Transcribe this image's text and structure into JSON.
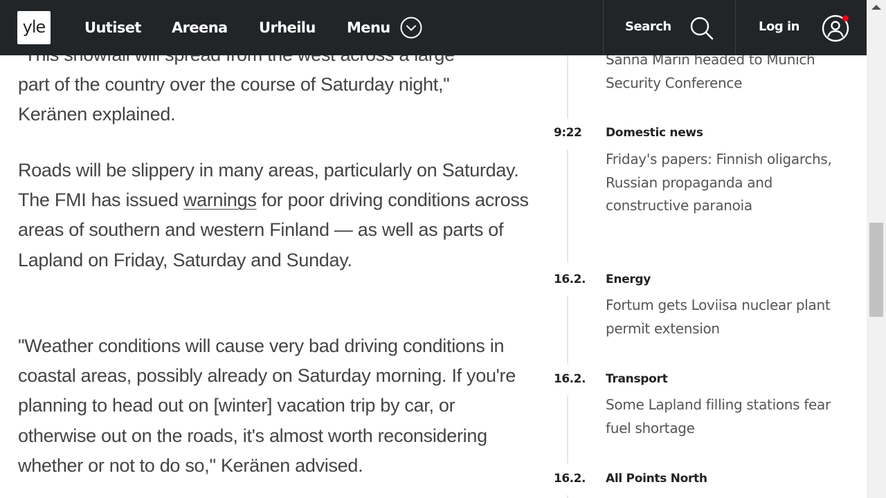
{
  "header": {
    "logo": "yle",
    "nav": [
      "Uutiset",
      "Areena",
      "Urheilu",
      "Menu"
    ],
    "search_label": "Search",
    "login_label": "Log in",
    "notification_color": "#e8001c"
  },
  "article": {
    "paragraphs": [
      {
        "lines": [
          "\"This snowfall will spread from the west across a large",
          "part of the country over the course of Saturday night,\"",
          "Keränen explained."
        ]
      },
      {
        "before_link": "Roads will be slippery in many areas, particularly on Saturday. The FMI has issued ",
        "link": "warnings",
        "after_link": " for poor driving conditions across areas of southern and western Finland — as well as parts of Lapland on Friday, Saturday and Sunday."
      },
      {
        "text": "\"Weather conditions will cause very bad driving conditions in coastal areas, possibly already on Saturday morning. If you're planning to head out on [winter] vacation trip by car, or otherwise out on the roads, it's almost worth reconsidering whether or not to do so,\" Keränen advised."
      }
    ]
  },
  "news_feed": {
    "items": [
      {
        "time": "",
        "category": "",
        "headline": "Sanna Marin headed to Munich Security Conference"
      },
      {
        "time": "9:22",
        "category": "Domestic news",
        "headline": "Friday's papers: Finnish oligarchs, Russian propaganda and constructive paranoia"
      },
      {
        "time": "16.2.",
        "category": "Energy",
        "headline": "Fortum gets Loviisa nuclear plant permit extension"
      },
      {
        "time": "16.2.",
        "category": "Transport",
        "headline": "Some Lapland filling stations fear fuel shortage"
      },
      {
        "time": "16.2.",
        "category": "All Points North",
        "headline": ""
      }
    ]
  }
}
